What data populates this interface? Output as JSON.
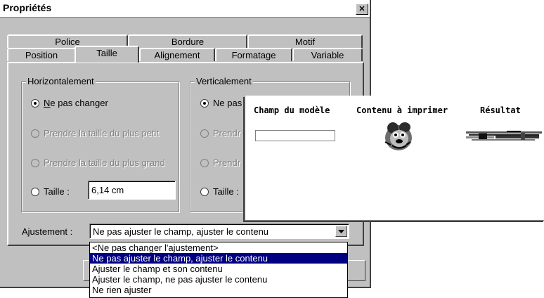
{
  "window": {
    "title": "Propriétés"
  },
  "tabs": {
    "back_row": [
      "Police",
      "Bordure",
      "Motif"
    ],
    "front_row": [
      "Position",
      "Taille",
      "Alignement",
      "Formatage",
      "Variable"
    ],
    "active": "Taille"
  },
  "horizontal": {
    "legend": "Horizontalement",
    "options": [
      {
        "mnemonic": "N",
        "rest": "e pas changer",
        "selected": true,
        "enabled": true
      },
      {
        "label": "Prendre la taille du plus petit",
        "enabled": false
      },
      {
        "label": "Prendre la taille du plus grand",
        "enabled": false
      },
      {
        "label": "Taille :",
        "enabled": true
      }
    ],
    "size_value": "6,14 cm"
  },
  "vertical": {
    "legend": "Verticalement",
    "options": [
      {
        "label_visible": "Ne pas",
        "selected": true,
        "enabled": true
      },
      {
        "label_visible": "Prendr",
        "enabled": false
      },
      {
        "label_visible": "Prendr",
        "enabled": false
      },
      {
        "label_visible": "Taille :",
        "enabled": true
      }
    ]
  },
  "adjustment": {
    "label": "Ajustement :",
    "value": "Ne pas ajuster le champ, ajuster le contenu",
    "options": [
      "<Ne pas changer l'ajustement>",
      "Ne pas ajuster le champ, ajuster le contenu",
      "Ajuster le champ et son contenu",
      "Ajuster le champ, ne pas ajuster le contenu",
      "Ne rien ajuster"
    ],
    "selected_index": 1
  },
  "preview": {
    "columns": [
      "Champ du modèle",
      "Contenu à imprimer",
      "Résultat"
    ],
    "content_icon": "cartoon-character-icon",
    "result_icon": "scrambled-result-icon"
  }
}
